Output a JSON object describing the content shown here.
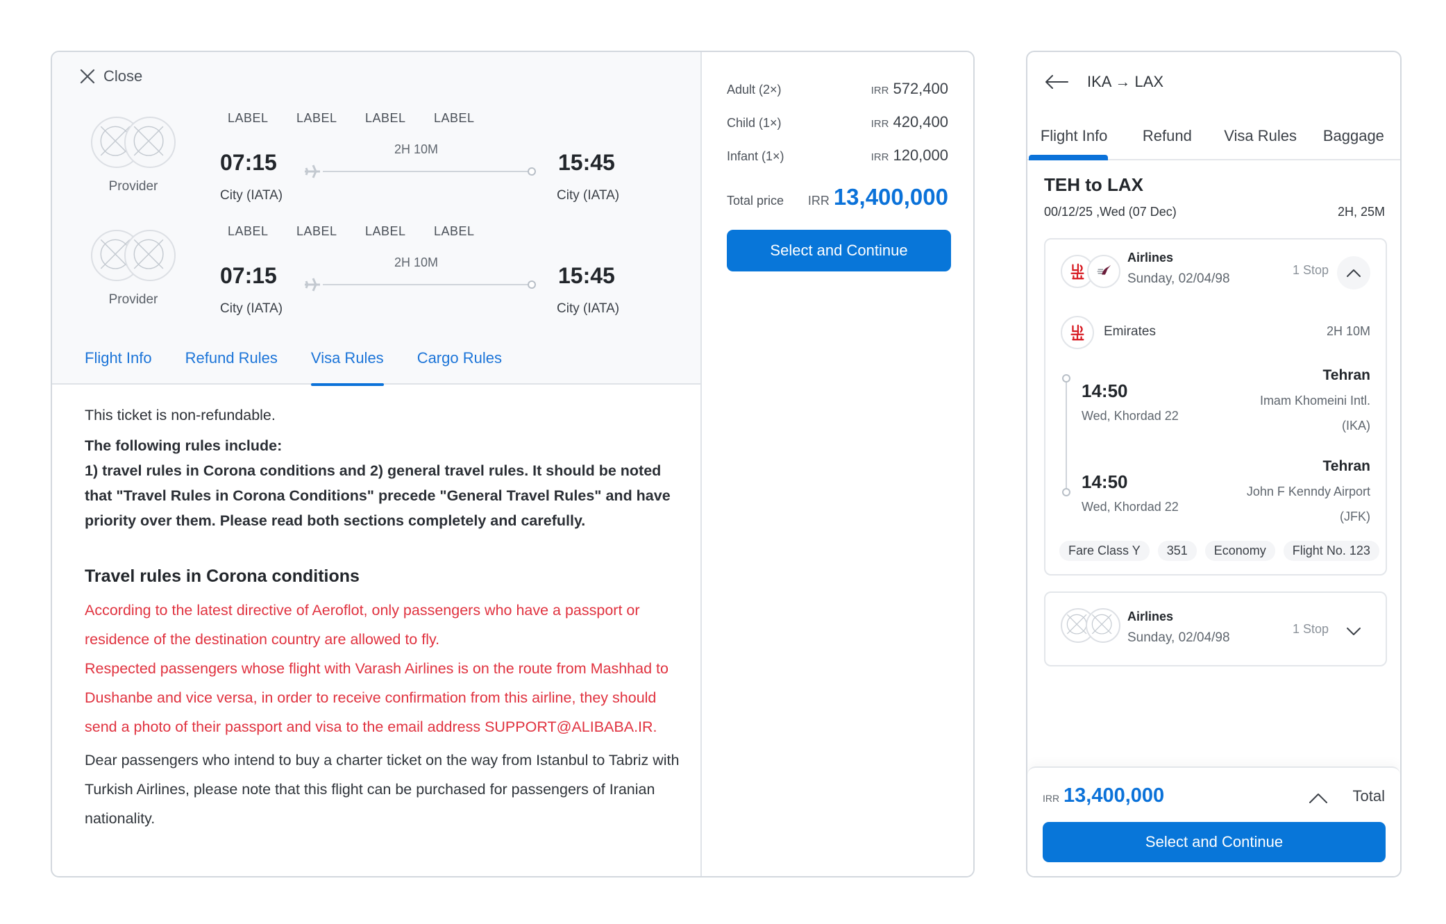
{
  "desktop": {
    "close_label": "Close",
    "flights": [
      {
        "provider": "Provider",
        "labels": [
          "LABEL",
          "LABEL",
          "LABEL",
          "LABEL"
        ],
        "depart_time": "07:15",
        "depart_city": "City (IATA)",
        "duration": "2H 10M",
        "arrive_time": "15:45",
        "arrive_city": "City (IATA)"
      },
      {
        "provider": "Provider",
        "labels": [
          "LABEL",
          "LABEL",
          "LABEL",
          "LABEL"
        ],
        "depart_time": "07:15",
        "depart_city": "City (IATA)",
        "duration": "2H 10M",
        "arrive_time": "15:45",
        "arrive_city": "City (IATA)"
      }
    ],
    "tabs": [
      {
        "label": "Flight Info",
        "active": false
      },
      {
        "label": "Refund Rules",
        "active": false
      },
      {
        "label": "Visa Rules",
        "active": true
      },
      {
        "label": "Cargo Rules",
        "active": false
      }
    ],
    "content": {
      "intro": "This ticket is non-refundable.",
      "bold_heading": "The following rules include:",
      "bold_body": "1) travel rules in Corona conditions and 2) general travel rules. It should be noted that \"Travel Rules in Corona Conditions\" precede \"General Travel Rules\" and have priority over them. Please read both sections completely and carefully.",
      "section_title": "Travel rules in Corona conditions",
      "red_paragraph_1": "According to the latest directive of Aeroflot, only passengers who have a passport or residence of the destination country are allowed to fly.",
      "red_paragraph_2": "Respected passengers whose flight with Varash Airlines is on the route from Mashhad to Dushanbe and vice versa, in order to receive confirmation from this airline, they should send a photo of their passport and visa to the email address SUPPORT@ALIBABA.IR.",
      "gray_paragraph": "Dear passengers who intend to buy a charter ticket on the way from Istanbul to Tabriz with Turkish Airlines, please note that this flight can be purchased for passengers of Iranian nationality."
    },
    "pricing": {
      "currency": "IRR",
      "rows": [
        {
          "label": "Adult (2×)",
          "value": "572,400"
        },
        {
          "label": "Child (1×)",
          "value": "420,400"
        },
        {
          "label": "Infant (1×)",
          "value": "120,000"
        }
      ],
      "total_label": "Total price",
      "total_value": "13,400,000",
      "button_label": "Select and Continue"
    }
  },
  "mobile": {
    "route": "IKA → LAX",
    "tabs": [
      {
        "label": "Flight Info",
        "active": true
      },
      {
        "label": "Refund",
        "active": false
      },
      {
        "label": "Visa Rules",
        "active": false
      },
      {
        "label": "Baggage",
        "active": false
      }
    ],
    "title": "TEH to LAX",
    "date": "00/12/25 ,Wed (07 Dec)",
    "duration": "2H, 25M",
    "cards": [
      {
        "airline": "Airlines",
        "date": "Sunday, 02/04/98",
        "stops": "1 Stop",
        "expanded": true,
        "segment": {
          "carrier": "Emirates",
          "duration": "2H 10M",
          "departure": {
            "time": "14:50",
            "date": "Wed, Khordad 22",
            "city": "Tehran",
            "airport": "Imam Khomeini Intl.",
            "code": "(IKA)"
          },
          "arrival": {
            "time": "14:50",
            "date": "Wed, Khordad 22",
            "city": "Tehran",
            "airport": "John F Kenndy Airport",
            "code": "(JFK)"
          },
          "chips": [
            "Fare Class Y",
            "351",
            "Economy",
            "Flight No. 123"
          ]
        }
      },
      {
        "airline": "Airlines",
        "date": "Sunday, 02/04/98",
        "stops": "1 Stop",
        "expanded": false
      }
    ],
    "footer": {
      "currency": "IRR",
      "total": "13,400,000",
      "total_label": "Total",
      "button_label": "Select and Continue"
    }
  },
  "colors": {
    "primary": "#0876d9",
    "warning_text": "#e0323f",
    "header_bg": "#f8f9fb"
  }
}
